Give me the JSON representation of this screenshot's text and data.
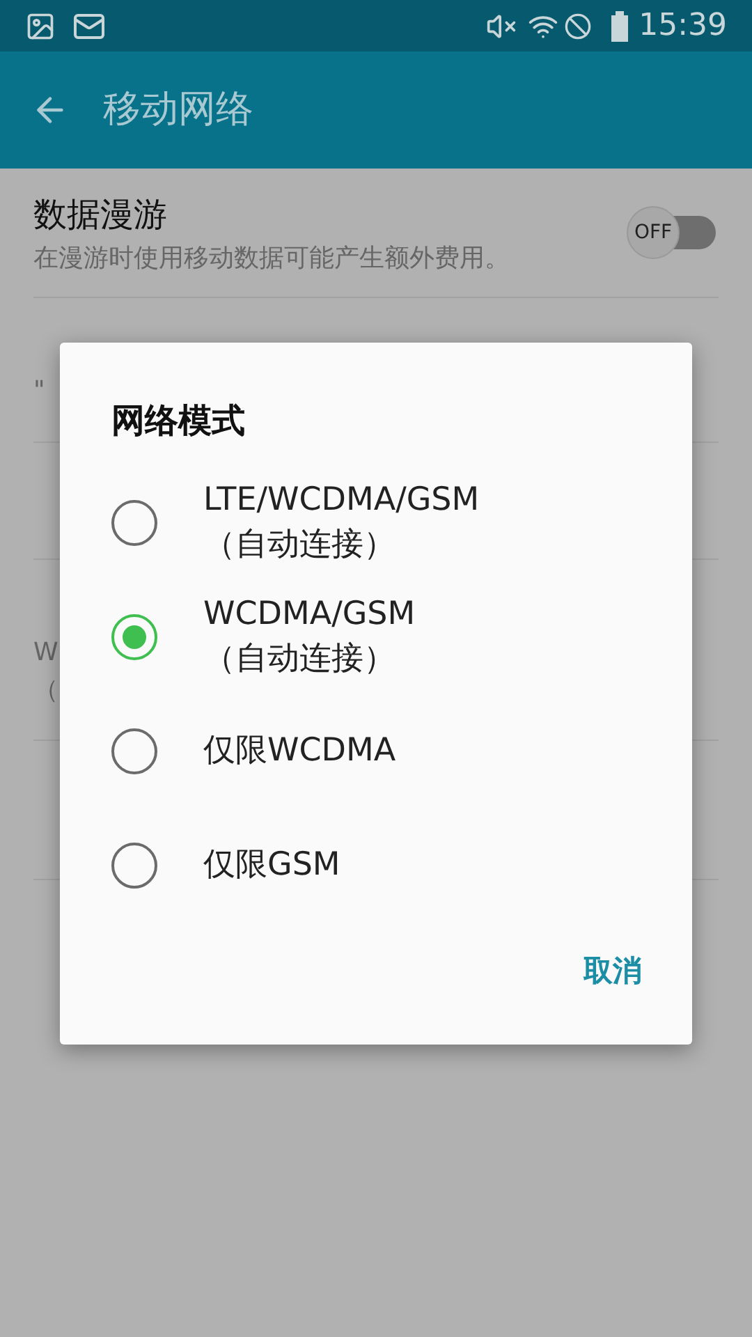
{
  "status_bar": {
    "time": "15:39"
  },
  "app_bar": {
    "title": "移动网络"
  },
  "settings": [
    {
      "title": "数据漫游",
      "subtitle": "在漫游时使用移动数据可能产生额外费用。",
      "switch": {
        "on": false,
        "label": "OFF"
      }
    },
    {
      "subtitle": "\""
    },
    {
      "subtitle": "W",
      "subtitle_2": "（"
    }
  ],
  "dialog": {
    "title": "网络模式",
    "options": [
      {
        "label": "LTE/WCDMA/GSM",
        "sublabel": "（自动连接）",
        "selected": false
      },
      {
        "label": "WCDMA/GSM",
        "sublabel": "（自动连接）",
        "selected": true
      },
      {
        "label": "仅限WCDMA",
        "selected": false
      },
      {
        "label": "仅限GSM",
        "selected": false
      }
    ],
    "cancel": "取消"
  }
}
